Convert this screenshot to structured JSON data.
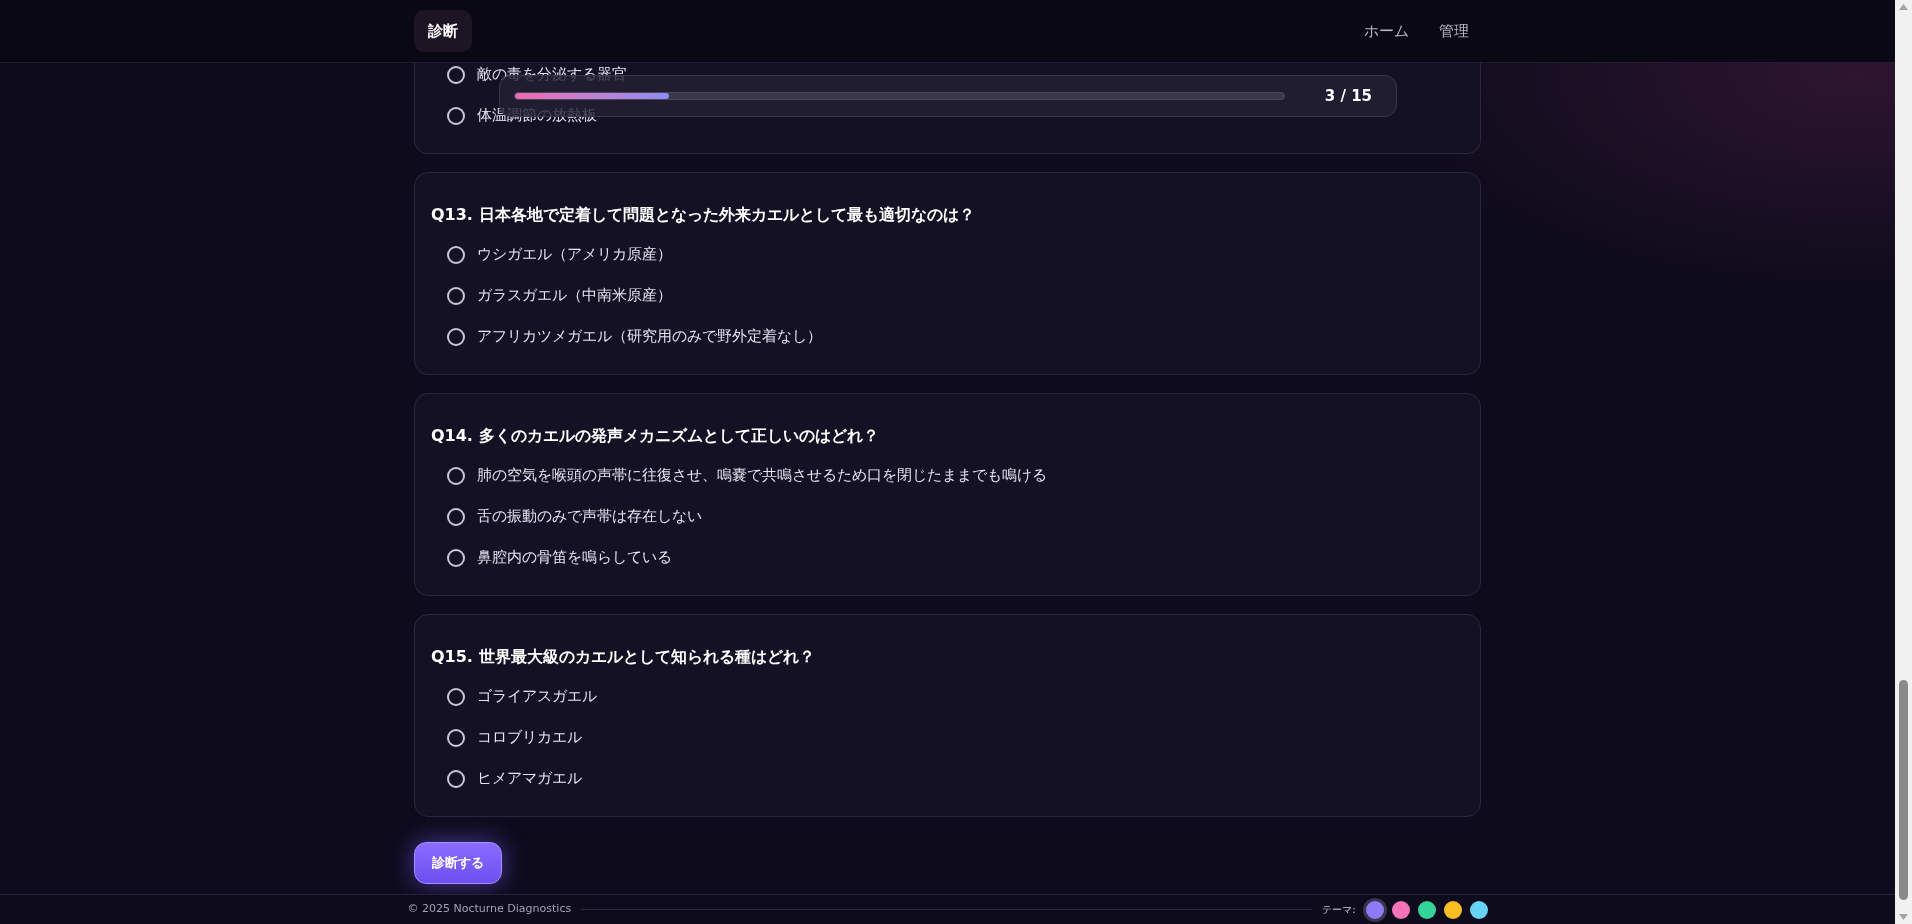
{
  "header": {
    "logo": "診断",
    "nav": [
      {
        "label": "ホーム"
      },
      {
        "label": "管理"
      }
    ]
  },
  "progress": {
    "level": 0.2,
    "reading": "3 / 15"
  },
  "partial_question": {
    "options": [
      {
        "label": "敵の毒を分泌する器官",
        "selected": false
      },
      {
        "label": "体温調節の放熱板",
        "selected": false
      }
    ]
  },
  "questions": [
    {
      "title": "Q13. 日本各地で定着して問題となった外来カエルとして最も適切なのは？",
      "options": [
        {
          "label": "ウシガエル（アメリカ原産）",
          "selected": false
        },
        {
          "label": "ガラスガエル（中南米原産）",
          "selected": false
        },
        {
          "label": "アフリカツメガエル（研究用のみで野外定着なし）",
          "selected": false
        }
      ]
    },
    {
      "title": "Q14. 多くのカエルの発声メカニズムとして正しいのはどれ？",
      "options": [
        {
          "label": "肺の空気を喉頭の声帯に往復させ、鳴嚢で共鳴させるため口を閉じたままでも鳴ける",
          "selected": false
        },
        {
          "label": "舌の振動のみで声帯は存在しない",
          "selected": false
        },
        {
          "label": "鼻腔内の骨笛を鳴らしている",
          "selected": false
        }
      ]
    },
    {
      "title": "Q15. 世界最大級のカエルとして知られる種はどれ？",
      "options": [
        {
          "label": "ゴライアスガエル",
          "selected": false
        },
        {
          "label": "コロブリカエル",
          "selected": false
        },
        {
          "label": "ヒメアマガエル",
          "selected": false
        }
      ]
    }
  ],
  "submit_button": "診断する",
  "footer": {
    "copyright": "© 2025 Nocturne Diagnostics",
    "theme_label": "テーマ:",
    "themes": [
      {
        "color": "#8b7cf6",
        "selected": true
      },
      {
        "color": "#f472b6",
        "selected": false
      },
      {
        "color": "#34d399",
        "selected": false
      },
      {
        "color": "#fbbf24",
        "selected": false
      },
      {
        "color": "#67d3f5",
        "selected": false
      }
    ]
  }
}
